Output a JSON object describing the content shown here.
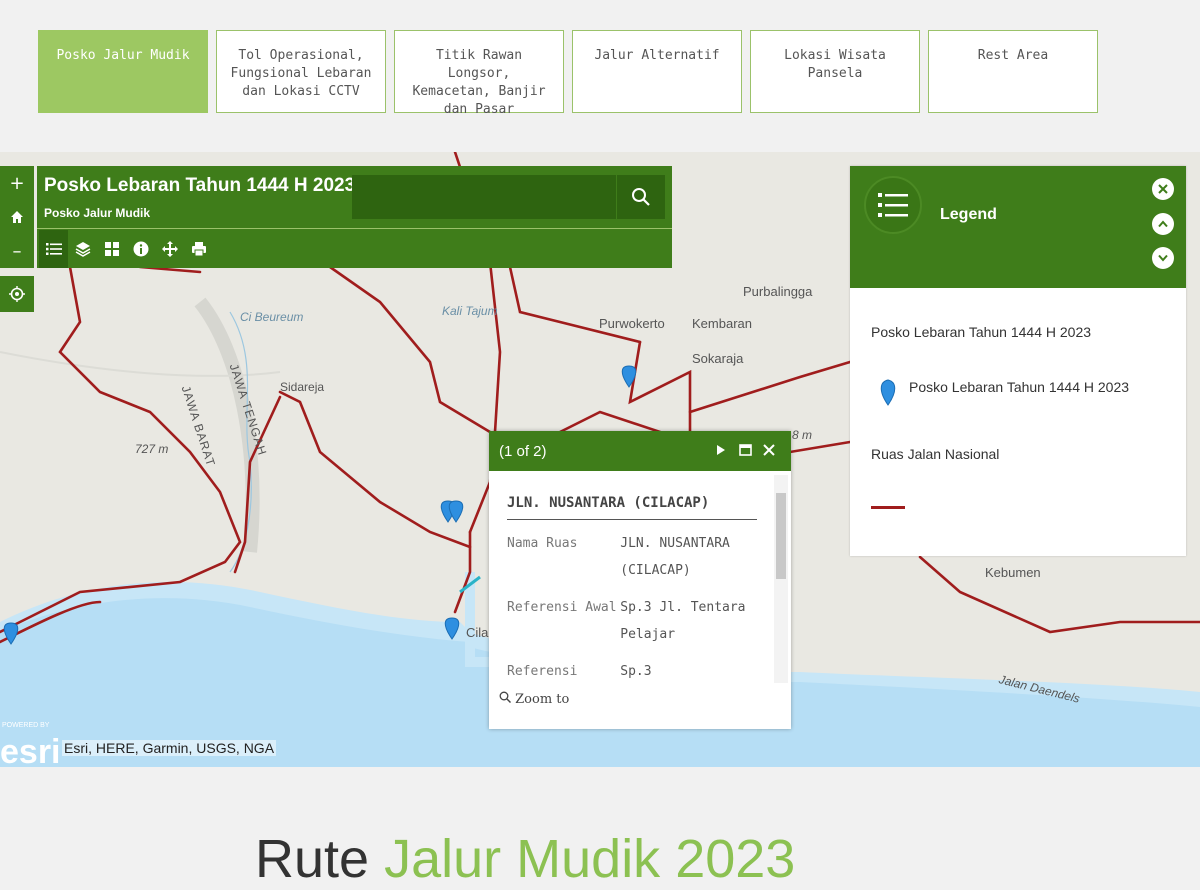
{
  "tabs": [
    {
      "label": "Posko Jalur Mudik",
      "active": true
    },
    {
      "label": "Tol Operasional,\nFungsional Lebaran\ndan Lokasi CCTV"
    },
    {
      "label": "Titik Rawan Longsor,\nKemacetan, Banjir\ndan Pasar"
    },
    {
      "label": "Jalur Alternatif"
    },
    {
      "label": "Lokasi Wisata\nPansela"
    },
    {
      "label": "Rest Area"
    }
  ],
  "map": {
    "title": "Posko Lebaran Tahun 1444 H 2023",
    "subtitle": "Posko Jalur Mudik",
    "search": {
      "placeholder": "",
      "value": ""
    },
    "zoom_in": "+",
    "zoom_out": "–",
    "attribution": "Esri, HERE, Garmin, USGS, NGA",
    "labels": {
      "purbalingga": "Purbalingga",
      "purwokerto": "Purwokerto",
      "kembaran": "Kembaran",
      "sokaraja": "Sokaraja",
      "sidareja": "Sidareja",
      "jawa_barat": "JAWA BARAT",
      "jawa_tengah": "JAWA TENGAH",
      "elev_727": "727 m",
      "elev_8m": "8 m",
      "ci_beureum": "Ci Beureum",
      "kali_tajum": "Kali Tajum",
      "kebumen": "Kebumen",
      "jalan_daendels": "Jalan Daendels",
      "cilacap": "Cila"
    }
  },
  "legend": {
    "title": "Legend",
    "layer1_title": "Posko Lebaran Tahun 1444 H 2023",
    "layer1_item": "Posko Lebaran Tahun 1444 H 2023",
    "layer2_title": "Ruas Jalan Nasional"
  },
  "popup": {
    "count": "(1 of 2)",
    "title": "JLN. NUSANTARA (CILACAP)",
    "rows": [
      {
        "key": "Nama Ruas",
        "value": "JLN. NUSANTARA (CILACAP)"
      },
      {
        "key": "Referensi Awal",
        "value": "Sp.3 Jl. Tentara Pelajar"
      },
      {
        "key": "Referensi Akhir",
        "value": "Sp.3"
      }
    ],
    "zoom_to": "Zoom to"
  },
  "page_heading": {
    "part1": "Rute",
    "part2": "Jalur Mudik 2023"
  },
  "colors": {
    "accent": "#3f7d1a",
    "tab_active": "#9dc862",
    "road": "#a01d1d",
    "water": "#c7e6f7",
    "pin": "#2e8fe0"
  }
}
